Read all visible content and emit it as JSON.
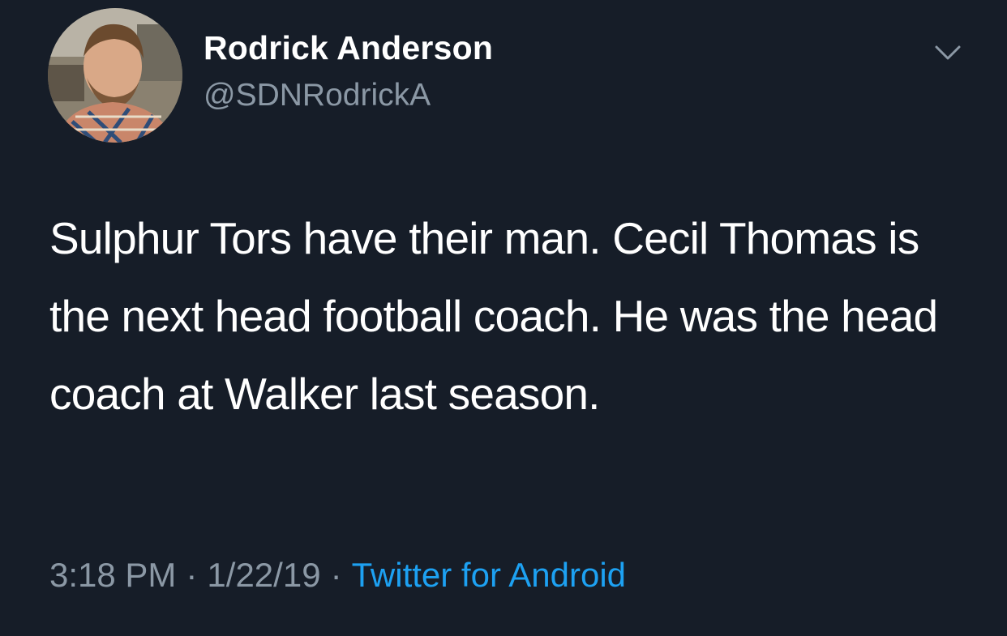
{
  "tweet": {
    "author": {
      "display_name": "Rodrick Anderson",
      "handle": "@SDNRodrickA"
    },
    "text": "Sulphur Tors have their man. Cecil Thomas is the next head football coach. He was the head coach at Walker last season.",
    "meta": {
      "time": "3:18 PM",
      "separator": "·",
      "date": "1/22/19",
      "source": "Twitter for Android"
    }
  },
  "icons": {
    "menu": "chevron-down-icon"
  },
  "colors": {
    "background": "#161d28",
    "primary_text": "#ffffff",
    "secondary_text": "#8b98a5",
    "link": "#1da1f2"
  }
}
